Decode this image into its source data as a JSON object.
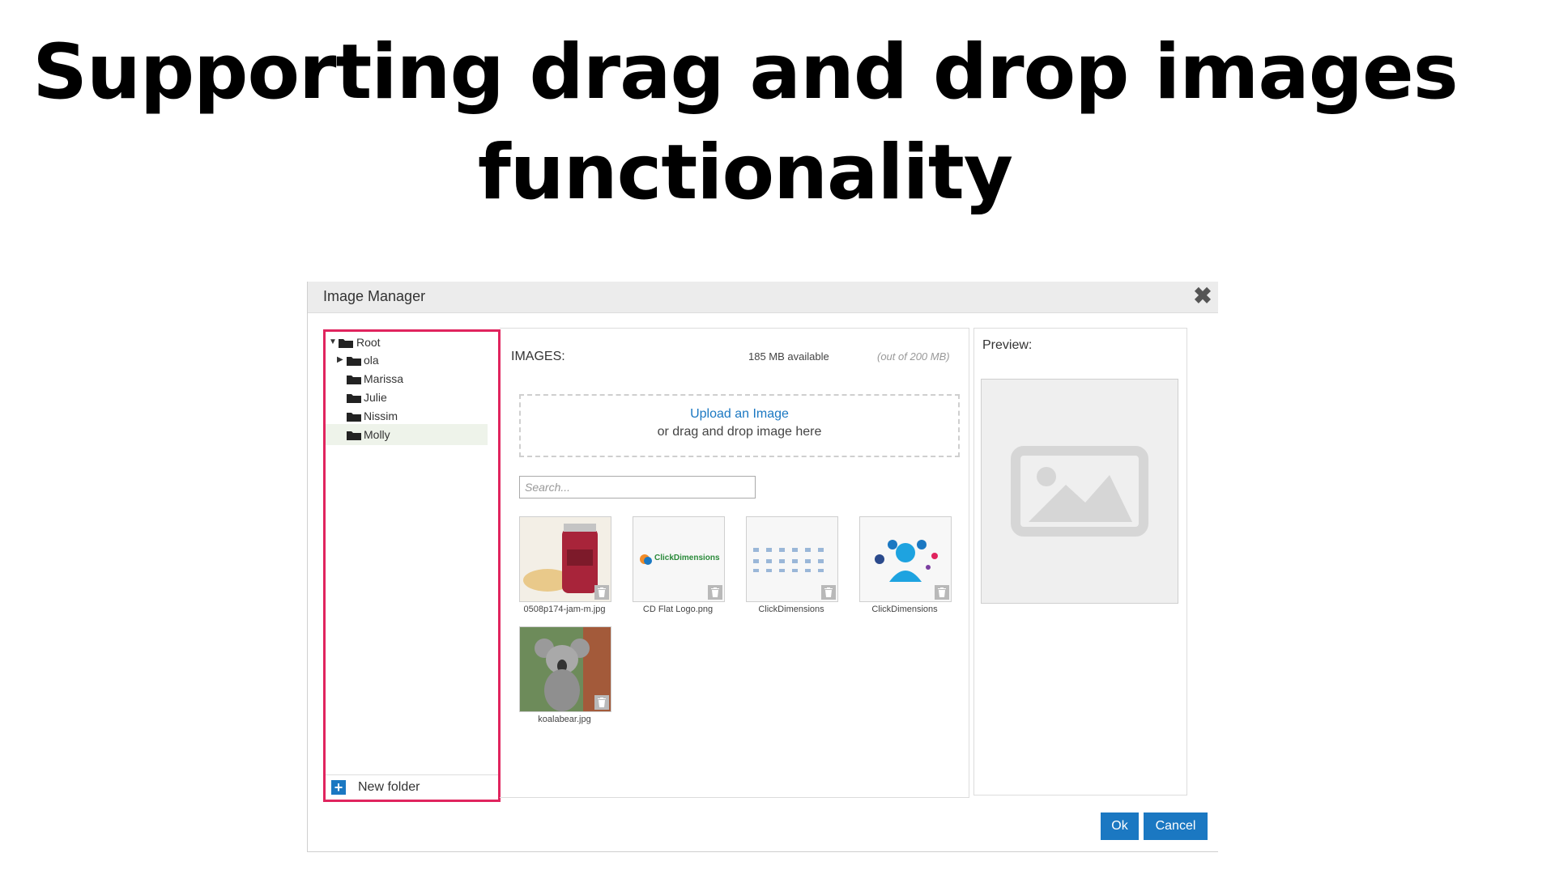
{
  "headline": {
    "line1": "Supporting drag and drop images",
    "line2": "functionality"
  },
  "dialog": {
    "title": "Image Manager",
    "close_icon": "close-icon"
  },
  "tree": {
    "root": "Root",
    "folders": [
      "ola",
      "Marissa",
      "Julie",
      "Nissim",
      "Molly"
    ],
    "selected": "Molly",
    "new_folder": "New folder",
    "highlight_color": "#e0245e"
  },
  "images": {
    "heading": "IMAGES:",
    "available": "185 MB available",
    "out_of": "(out of 200 MB)",
    "upload_link": "Upload an Image",
    "drag_text": "or drag and drop image here",
    "search_placeholder": "Search...",
    "items": [
      {
        "name": "0508p174-jam-m.jpg"
      },
      {
        "name": "CD Flat Logo.png",
        "logo_text": "ClickDimensions"
      },
      {
        "name": "ClickDimensions"
      },
      {
        "name": "ClickDimensions"
      },
      {
        "name": "koalabear.jpg"
      }
    ]
  },
  "preview": {
    "label": "Preview:"
  },
  "buttons": {
    "ok": "Ok",
    "cancel": "Cancel"
  },
  "colors": {
    "accent": "#1b78c2",
    "highlight": "#e0245e"
  }
}
